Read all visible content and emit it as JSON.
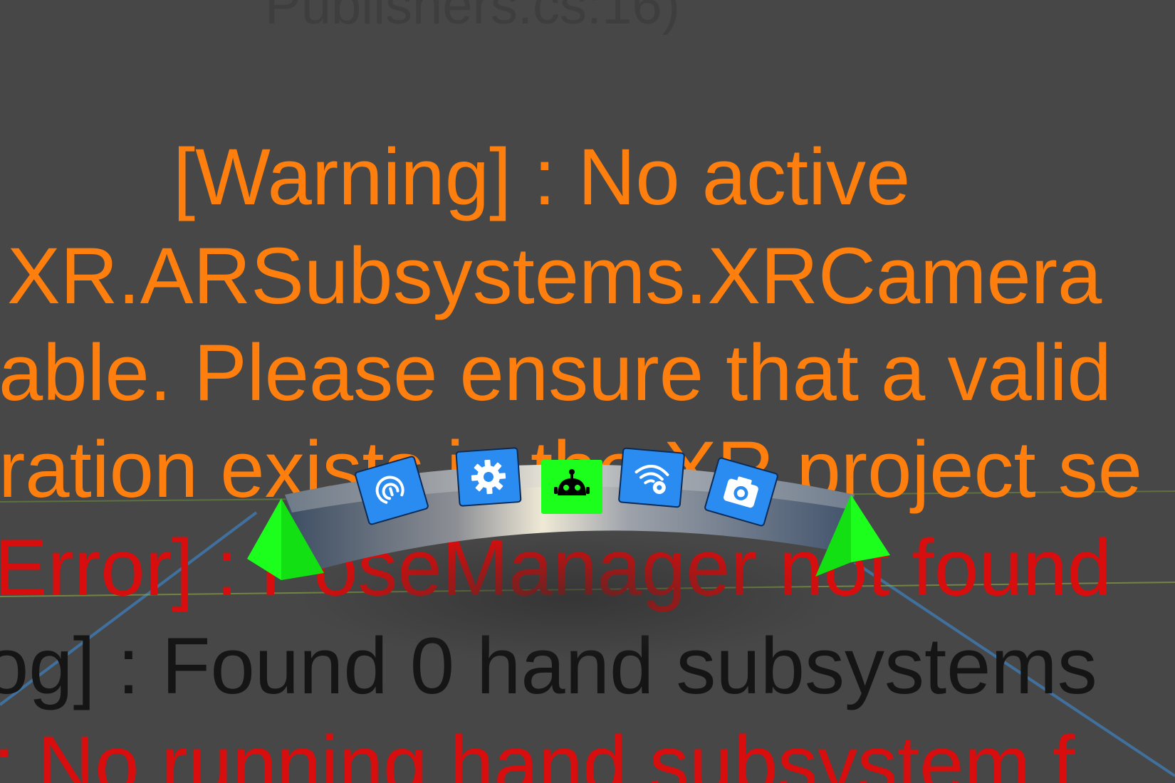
{
  "console": {
    "top_partial": "Publishers.cs:16)",
    "lines": [
      {
        "type": "warning",
        "text": "[Warning] : No active"
      },
      {
        "type": "warning",
        "text": "XR.ARSubsystems.XRCamera"
      },
      {
        "type": "warning",
        "text": "able. Please ensure that a valid"
      },
      {
        "type": "warning",
        "text": "ration exists in the XR project se"
      },
      {
        "type": "error",
        "text": "Error] : PoseManager not found"
      },
      {
        "type": "log",
        "text": "og] : Found 0 hand subsystems"
      },
      {
        "type": "error",
        "text": ": No running hand subsystem f"
      }
    ]
  },
  "hand_menu": {
    "items": [
      {
        "icon": "hand-tracking-icon",
        "active": false
      },
      {
        "icon": "settings-icon",
        "active": false
      },
      {
        "icon": "robot-icon",
        "active": true
      },
      {
        "icon": "wifi-settings-icon",
        "active": false
      },
      {
        "icon": "camera-icon",
        "active": false
      }
    ],
    "colors": {
      "tile_blue": "#2a8cf0",
      "tile_active": "#1cff1c",
      "arrow_green": "#1cff1c",
      "warning_text": "#ff7f0e",
      "error_text": "#d80d0d",
      "log_text": "#151515",
      "background": "#474747"
    }
  }
}
